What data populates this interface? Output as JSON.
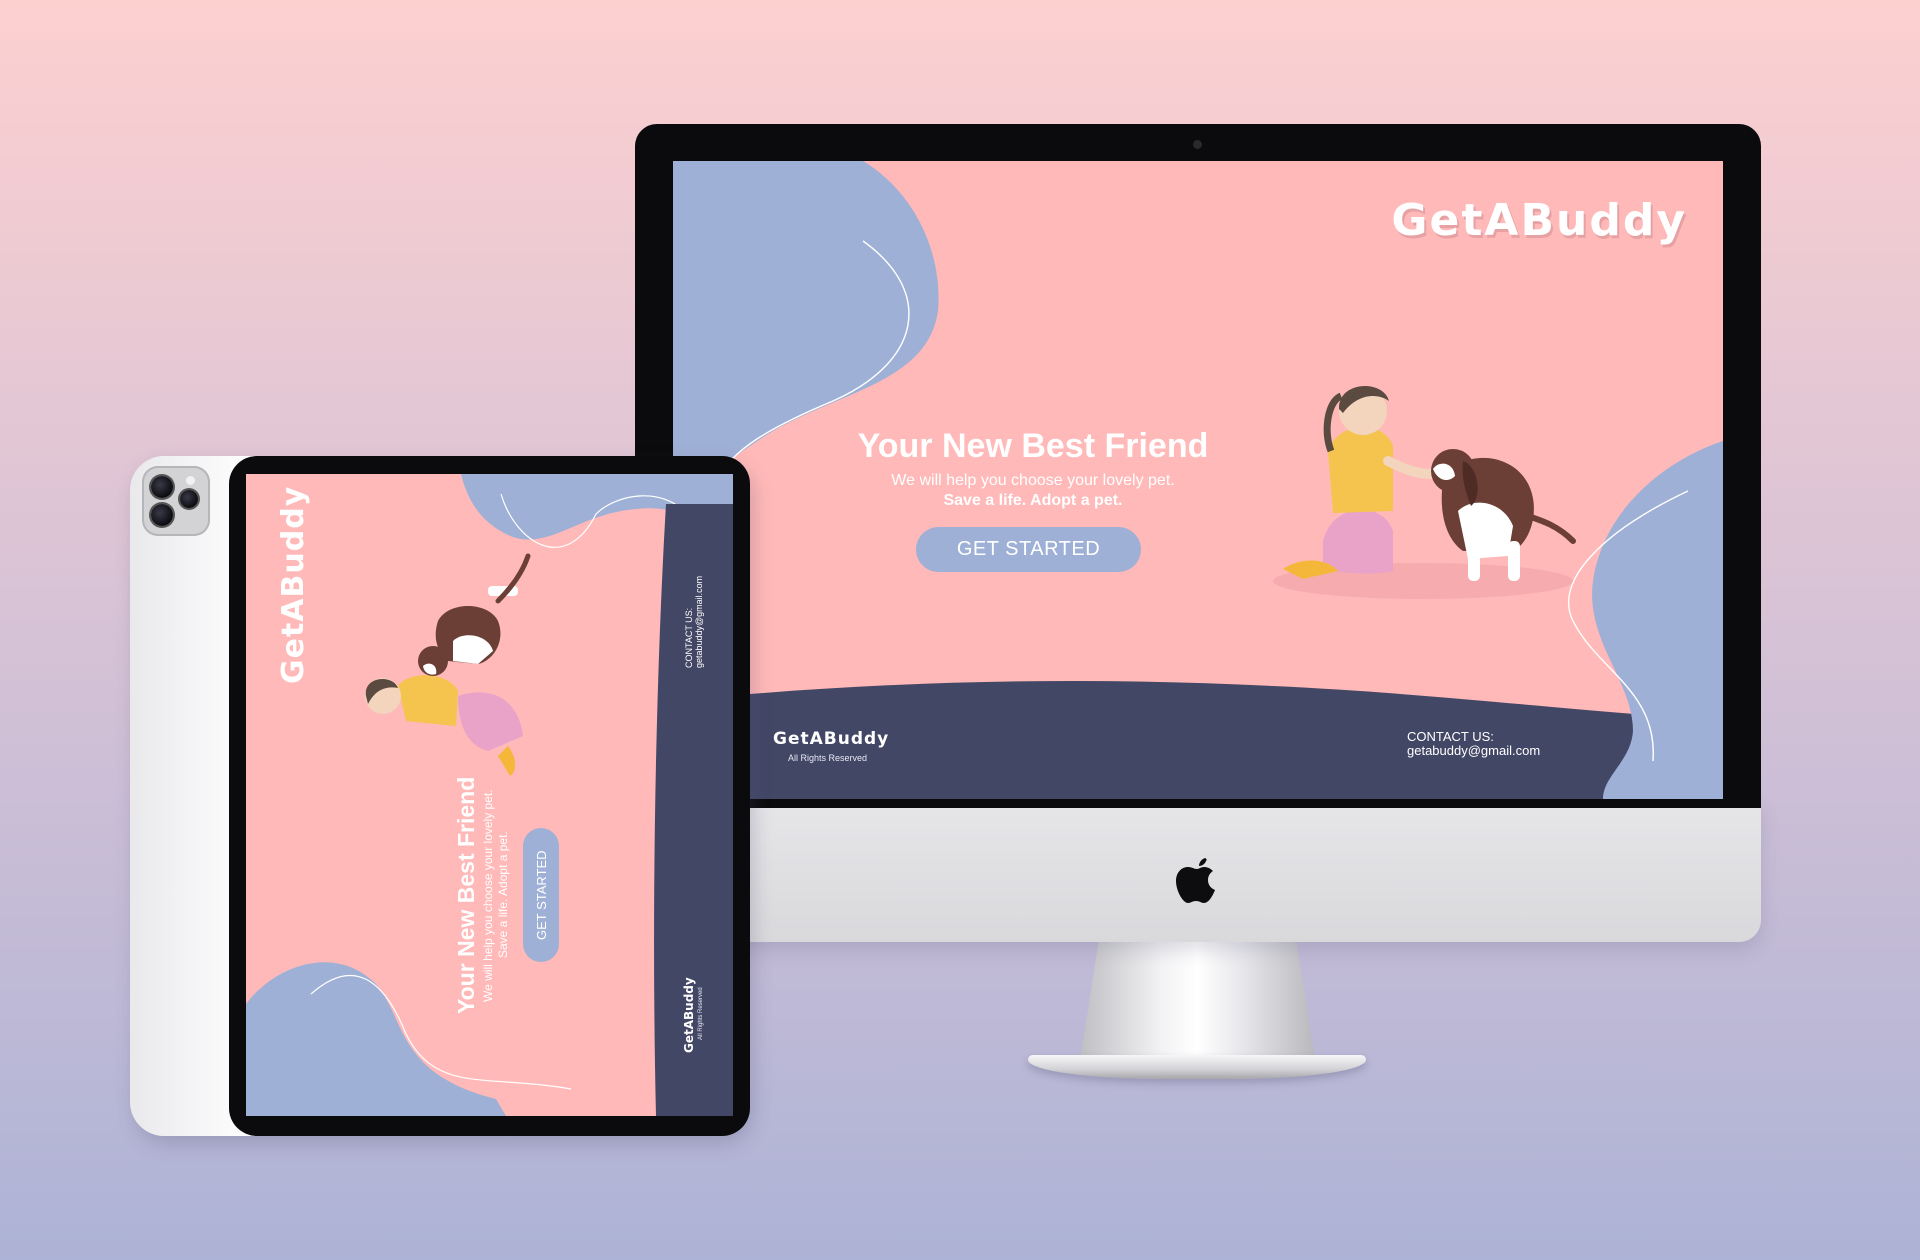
{
  "desktop": {
    "brand": "GetABuddy",
    "hero": {
      "title": "Your New Best Friend",
      "subtitle": "We will help you choose your lovely pet.",
      "tagline": "Save a life. Adopt a pet.",
      "cta_label": "GET STARTED"
    },
    "footer": {
      "brand": "GetABuddy",
      "rights": "All Rights Reserved",
      "contact_label": "CONTACT US:",
      "contact_email": "getabuddy@gmail.com"
    }
  },
  "tablet": {
    "brand": "GetABuddy",
    "hero": {
      "title": "Your New Best Friend",
      "subtitle": "We will help you choose your lovely pet.",
      "tagline": "Save a life. Adopt a pet.",
      "cta_label": "GET STARTED"
    },
    "footer": {
      "brand": "GetABuddy",
      "rights": "All Rights Reserved",
      "contact_label": "CONTACT US:",
      "contact_email": "getabuddy@gmail.com"
    }
  },
  "colors": {
    "page_bg_top": "#fdd0d0",
    "page_bg_bottom": "#adb3d6",
    "screen_pink": "#ffb9b8",
    "blob_blue": "#9fb0d6",
    "footer_navy": "#434766",
    "text_white": "#ffffff"
  },
  "icons": [
    "apple-logo-icon",
    "webcam-icon",
    "camera-lens-icon"
  ]
}
